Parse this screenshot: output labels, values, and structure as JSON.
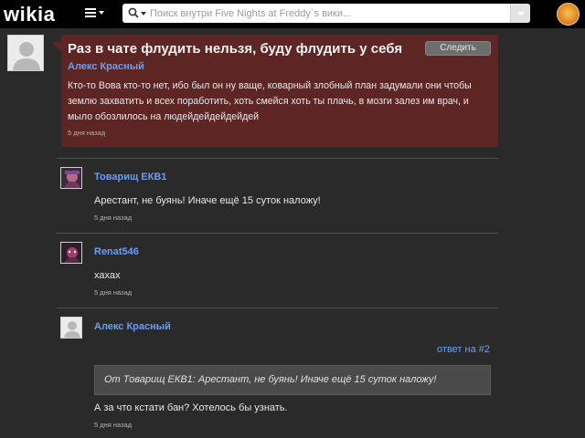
{
  "header": {
    "logo": "wikia",
    "search": {
      "placeholder": "Поиск внутри Five Nights at Freddy`s вики..."
    }
  },
  "thread": {
    "op": {
      "title": "Раз в чате флудить нельзя, буду флудить у себя",
      "follow_label": "Следить",
      "author": "Алекс Красный",
      "body": "Кто-то Вова кто-то нет, ибо был он ну ваще, коварный злобный план задумали они чтобы землю захватить и всех поработить, хоть смейся хоть ты плачь, в мозги залез им врач, и мыло обозлилось на людейдейдейдейдей",
      "time": "5 дня назад"
    },
    "replies": [
      {
        "author": "Товарищ ЕКВ1",
        "text": "Арестант, не буянь! Иначе ещё 15 суток наложу!",
        "time": "5 дня назад"
      },
      {
        "author": "Renat546",
        "text": "хахах",
        "time": "5 дня назад"
      },
      {
        "author": "Алекс Красный",
        "reply_link": "ответ на #2",
        "quote": "От Товарищ ЕКВ1: Арестант, не буянь! Иначе ещё 15 суток наложу!",
        "text": "А за что кстати бан? Хотелось бы узнать.",
        "time": "5 дня назад"
      }
    ]
  },
  "colors": {
    "background": "#2a2a2a",
    "op_box": "#5e2525",
    "link": "#6c9df3"
  }
}
